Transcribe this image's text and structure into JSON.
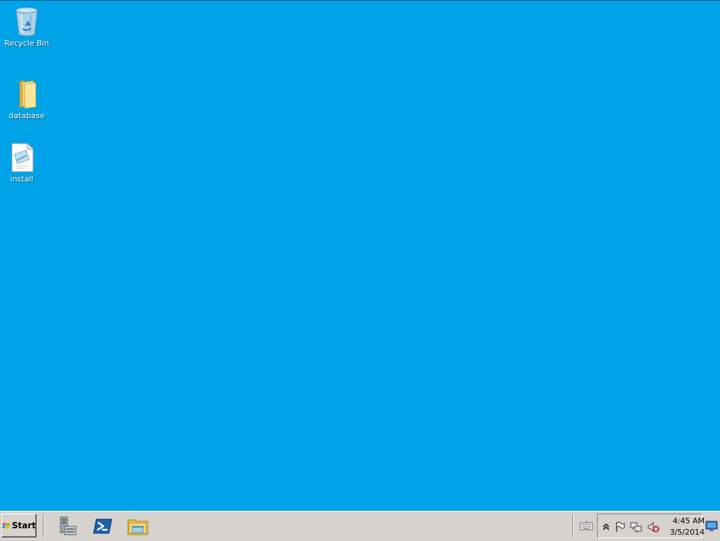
{
  "desktop": {
    "background_color": "#00a2e8",
    "icons": [
      {
        "label": "Recycle Bin",
        "icon": "recycle-bin-icon"
      },
      {
        "label": "database",
        "icon": "folder-icon"
      },
      {
        "label": "install",
        "icon": "text-document-icon"
      }
    ]
  },
  "taskbar": {
    "start_label": "Start",
    "pinned": [
      {
        "icon": "server-manager-icon"
      },
      {
        "icon": "powershell-icon"
      },
      {
        "icon": "file-explorer-icon"
      }
    ],
    "tray": {
      "icons": [
        "keyboard-icon",
        "show-hidden-icons-chevron-icon",
        "action-center-flag-icon",
        "network-icon",
        "volume-muted-icon"
      ]
    },
    "clock": {
      "time": "4:45 AM",
      "date": "3/5/2014"
    }
  }
}
